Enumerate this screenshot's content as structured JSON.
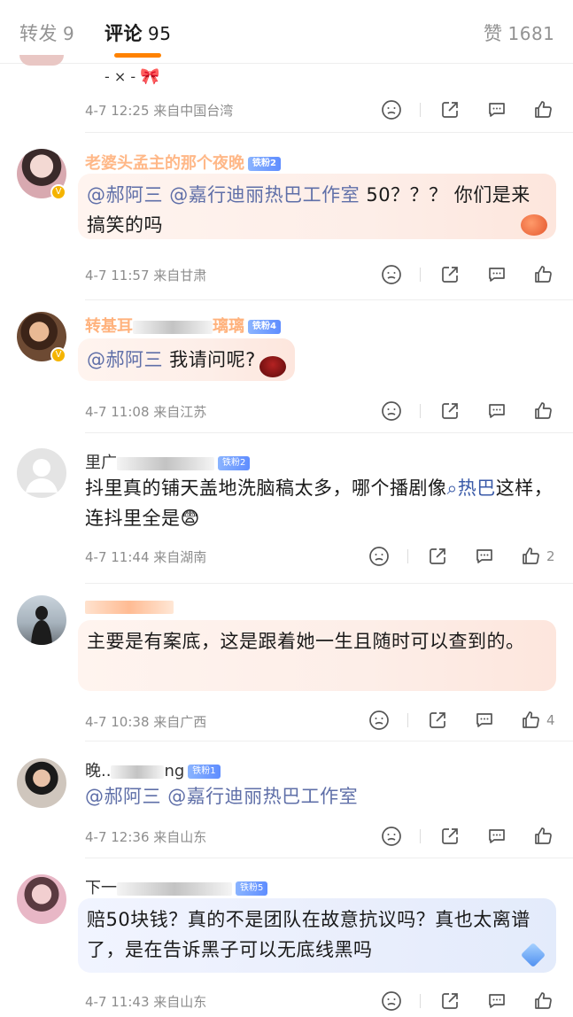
{
  "tabs": {
    "repost_label": "转发",
    "repost_count": "9",
    "comment_label": "评论",
    "comment_count": "95",
    "like_label": "赞",
    "like_count": "1681"
  },
  "colors": {
    "accent": "#ff8200",
    "username": "#ff7f27",
    "mention": "#5f6fa8"
  },
  "top_remnant": {
    "text": "- × -",
    "meta": "4-7 12:25 来自中国台湾"
  },
  "comments": [
    {
      "username": "老婆头孟主的那个夜晚",
      "fan_badge": "铁粉2",
      "mention1": "@郝阿三",
      "mention2": "@嘉行迪丽热巴工作室",
      "body": " 50？？？ 你们是来搞笑的吗",
      "meta": "4-7 11:57 来自甘肃",
      "likes": ""
    },
    {
      "username": "转基耳",
      "username_tail": "璃璃",
      "fan_badge": "铁粉4",
      "mention1": "@郝阿三",
      "body": " 我请问呢?",
      "meta": "4-7 11:08 来自江苏",
      "likes": ""
    },
    {
      "username": "里广",
      "fan_badge": "铁粉2",
      "body_a": "抖里真的铺天盖地洗脑稿太多，哪个播剧像",
      "topic": "热巴",
      "body_b": "这样，连抖里全是😨",
      "meta": "4-7 11:44 来自湖南",
      "likes": "2"
    },
    {
      "username": "",
      "fan_badge": "",
      "body": "主要是有案底，这是跟着她一生且随时可以查到的。",
      "meta": "4-7 10:38 来自广西",
      "likes": "4"
    },
    {
      "username": "晚..",
      "username_tail": "ng",
      "fan_badge": "铁粉1",
      "mention1": "@郝阿三",
      "mention2": "@嘉行迪丽热巴工作室",
      "meta": "4-7 12:36 来自山东",
      "likes": ""
    },
    {
      "username": "下一",
      "fan_badge": "铁粉5",
      "body": "赔50块钱？真的不是团队在故意抗议吗？真也太离谱了，是在告诉黑子可以无底线黑吗",
      "meta": "4-7 11:43 来自山东",
      "likes": ""
    }
  ]
}
